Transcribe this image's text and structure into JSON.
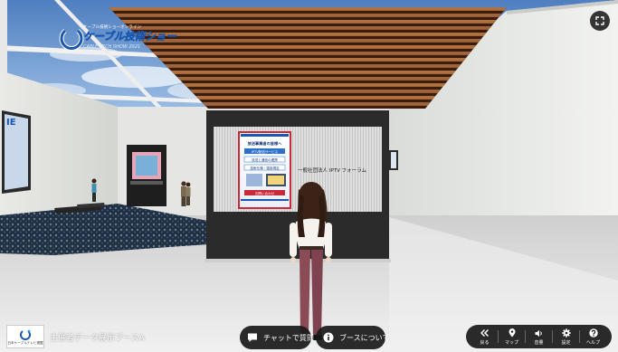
{
  "logo": {
    "tagline": "ケーブル技術ショーオンライン",
    "title": "ケーブル技術ショー",
    "subtitle": "CABLE TECH SHOW 2021"
  },
  "wall_sign": {
    "text": "IE"
  },
  "booth": {
    "name": "一般社団法人 IPTV フォーラム",
    "poster": {
      "heading": "放送事業者の皆様へ",
      "line1": "IPTV配信サービス",
      "line2": "放送と通信の連携",
      "line3": "技術仕様・運用規定",
      "line4": "お問い合わせ"
    }
  },
  "chat_button": {
    "label": "チャットで質問",
    "icon": "chat-icon"
  },
  "booth_info_button": {
    "label": "ブースについて",
    "icon": "info-icon"
  },
  "area_label": "主催者データ展示ブースA",
  "mini_logo_caption": "日本ケーブルテレビ連盟",
  "menu": [
    {
      "icon": "back-icon",
      "label": "戻る"
    },
    {
      "icon": "map-pin-icon",
      "label": "マップ"
    },
    {
      "icon": "volume-icon",
      "label": "音量"
    },
    {
      "icon": "gear-icon",
      "label": "設定"
    },
    {
      "icon": "help-icon",
      "label": "ヘルプ"
    }
  ],
  "colors": {
    "ui_dark": "#191919",
    "logo_blue": "#1a57b0",
    "floor": "#e8e8e8",
    "booth_dark": "#2b2b2b"
  }
}
